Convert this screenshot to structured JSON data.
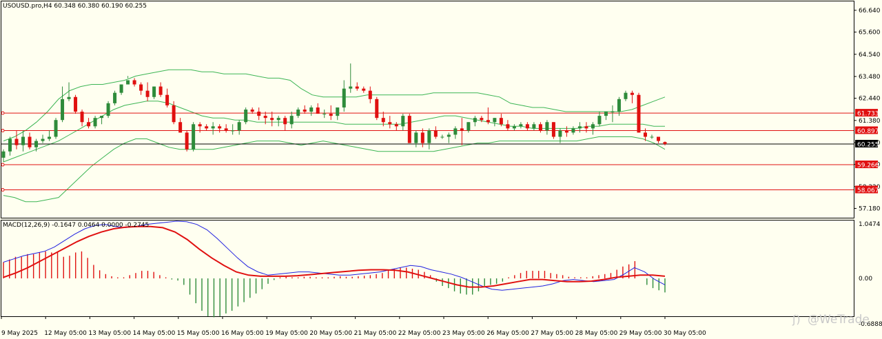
{
  "main_title": "USOUSD.pro,H4  60.348 60.380 60.190 60.255",
  "macd_title": "MACD(12,26,9) -0.1647 0.0464 0.0000 -0.2745",
  "watermark": "@WeTrade",
  "colors": {
    "bull": "#2e8b3a",
    "bear": "#e01010",
    "bands": "#3cb554",
    "macd_line": "#2020e0",
    "signal_line": "#e01010",
    "hline": "#e01010",
    "bg": "#fffff0"
  },
  "chart_data": [
    {
      "type": "candlestick",
      "symbol": "USOUSD.pro",
      "timeframe": "H4",
      "ohlc_label": "60.348 60.380 60.190 60.255",
      "ylim": [
        56.8,
        67.0
      ],
      "price_ticks": [
        "66.640",
        "65.600",
        "64.540",
        "63.480",
        "62.440",
        "61.380",
        "60.320",
        "59.280",
        "58.220",
        "57.180"
      ],
      "price_tags": [
        {
          "label": "61.733",
          "value": 61.733,
          "style": "red"
        },
        {
          "label": "60.897",
          "value": 60.897,
          "style": "red"
        },
        {
          "label": "60.255",
          "value": 60.255,
          "style": "current"
        },
        {
          "label": "59.266",
          "value": 59.266,
          "style": "red"
        },
        {
          "label": "58.067",
          "value": 58.067,
          "style": "red"
        }
      ],
      "horizontal_lines": [
        61.733,
        60.897,
        60.255,
        59.266,
        58.067
      ],
      "date_labels": [
        "9 May 2025",
        "12 May 05:00",
        "13 May 05:00",
        "14 May 05:00",
        "15 May 05:00",
        "16 May 05:00",
        "19 May 05:00",
        "20 May 05:00",
        "21 May 05:00",
        "22 May 05:00",
        "23 May 05:00",
        "26 May 05:00",
        "27 May 05:00",
        "28 May 05:00",
        "29 May 05:00",
        "30 May 05:00"
      ],
      "candles": [
        [
          59.6,
          60.0,
          59.4,
          59.9
        ],
        [
          59.9,
          60.6,
          59.7,
          60.5
        ],
        [
          60.5,
          60.9,
          60.0,
          60.2
        ],
        [
          60.2,
          60.9,
          59.9,
          60.6
        ],
        [
          60.6,
          60.8,
          60.0,
          60.1
        ],
        [
          60.1,
          60.5,
          59.9,
          60.4
        ],
        [
          60.4,
          60.7,
          60.3,
          60.5
        ],
        [
          60.5,
          60.9,
          60.4,
          60.6
        ],
        [
          60.6,
          61.5,
          60.5,
          61.4
        ],
        [
          61.4,
          63.0,
          61.3,
          62.4
        ],
        [
          62.4,
          63.2,
          62.3,
          62.5
        ],
        [
          62.5,
          62.6,
          61.7,
          61.8
        ],
        [
          61.8,
          61.9,
          61.1,
          61.3
        ],
        [
          61.3,
          61.5,
          61.0,
          61.1
        ],
        [
          61.1,
          61.6,
          61.0,
          61.5
        ],
        [
          61.5,
          61.6,
          61.2,
          61.6
        ],
        [
          61.6,
          62.3,
          61.5,
          62.2
        ],
        [
          62.2,
          62.8,
          62.1,
          62.7
        ],
        [
          62.7,
          63.1,
          62.6,
          63.1
        ],
        [
          63.1,
          63.5,
          63.4,
          63.3
        ],
        [
          63.3,
          63.4,
          63.0,
          63.1
        ],
        [
          63.1,
          63.2,
          62.6,
          62.8
        ],
        [
          62.8,
          63.2,
          62.3,
          62.5
        ],
        [
          62.5,
          63.0,
          62.4,
          63.0
        ],
        [
          63.0,
          63.2,
          62.5,
          62.6
        ],
        [
          62.6,
          62.9,
          62.0,
          62.1
        ],
        [
          62.1,
          62.3,
          61.2,
          61.3
        ],
        [
          61.3,
          61.5,
          60.8,
          60.8
        ],
        [
          60.8,
          60.9,
          59.9,
          60.0
        ],
        [
          60.0,
          61.3,
          59.9,
          61.2
        ],
        [
          61.2,
          61.3,
          60.8,
          61.1
        ],
        [
          61.1,
          61.2,
          60.9,
          61.0
        ],
        [
          61.0,
          61.3,
          60.7,
          61.1
        ],
        [
          61.1,
          61.2,
          60.8,
          61.0
        ],
        [
          61.0,
          61.2,
          60.8,
          60.9
        ],
        [
          60.9,
          61.2,
          60.7,
          60.9
        ],
        [
          60.9,
          61.4,
          60.7,
          61.3
        ],
        [
          61.3,
          62.0,
          61.2,
          61.9
        ],
        [
          61.9,
          62.0,
          61.7,
          61.8
        ],
        [
          61.8,
          62.0,
          61.4,
          61.6
        ],
        [
          61.6,
          61.8,
          61.2,
          61.5
        ],
        [
          61.5,
          61.8,
          61.1,
          61.4
        ],
        [
          61.4,
          61.6,
          61.1,
          61.5
        ],
        [
          61.5,
          61.6,
          60.9,
          61.2
        ],
        [
          61.2,
          61.8,
          61.0,
          61.6
        ],
        [
          61.6,
          62.0,
          61.5,
          61.9
        ],
        [
          61.9,
          62.1,
          61.7,
          61.8
        ],
        [
          61.8,
          62.1,
          61.6,
          62.0
        ],
        [
          62.0,
          62.2,
          61.7,
          61.7
        ],
        [
          61.7,
          61.9,
          61.5,
          61.7
        ],
        [
          61.7,
          62.1,
          61.4,
          61.6
        ],
        [
          61.6,
          62.0,
          61.4,
          62.0
        ],
        [
          62.0,
          63.3,
          61.8,
          62.9
        ],
        [
          62.9,
          64.1,
          62.7,
          63.0
        ],
        [
          63.0,
          63.2,
          62.8,
          62.9
        ],
        [
          62.9,
          63.0,
          62.7,
          62.8
        ],
        [
          62.8,
          63.0,
          62.2,
          62.4
        ],
        [
          62.4,
          62.5,
          61.4,
          61.5
        ],
        [
          61.5,
          61.8,
          61.1,
          61.3
        ],
        [
          61.3,
          61.6,
          61.0,
          61.2
        ],
        [
          61.2,
          61.3,
          60.9,
          61.1
        ],
        [
          61.1,
          61.7,
          60.9,
          61.6
        ],
        [
          61.6,
          61.7,
          60.3,
          60.3
        ],
        [
          60.3,
          60.9,
          60.1,
          60.8
        ],
        [
          60.8,
          61.0,
          60.1,
          60.3
        ],
        [
          60.3,
          61.0,
          60.0,
          60.9
        ],
        [
          60.9,
          61.1,
          60.5,
          60.6
        ],
        [
          60.6,
          60.7,
          60.5,
          60.6
        ],
        [
          60.6,
          60.8,
          60.3,
          60.7
        ],
        [
          60.7,
          61.1,
          60.5,
          61.0
        ],
        [
          61.0,
          61.5,
          60.2,
          60.9
        ],
        [
          60.9,
          61.3,
          60.8,
          61.3
        ],
        [
          61.3,
          61.6,
          61.1,
          61.5
        ],
        [
          61.5,
          61.6,
          61.3,
          61.4
        ],
        [
          61.4,
          62.0,
          61.2,
          61.3
        ],
        [
          61.3,
          61.5,
          61.1,
          61.5
        ],
        [
          61.5,
          61.7,
          61.1,
          61.2
        ],
        [
          61.2,
          61.4,
          60.9,
          61.0
        ],
        [
          61.0,
          61.2,
          60.9,
          61.1
        ],
        [
          61.1,
          61.3,
          61.0,
          61.2
        ],
        [
          61.2,
          61.3,
          60.9,
          61.0
        ],
        [
          61.0,
          61.3,
          60.9,
          61.2
        ],
        [
          61.2,
          61.3,
          60.8,
          60.9
        ],
        [
          60.9,
          61.4,
          60.7,
          61.3
        ],
        [
          61.3,
          61.3,
          60.5,
          60.6
        ],
        [
          60.6,
          61.0,
          60.3,
          60.9
        ],
        [
          60.9,
          61.1,
          60.6,
          60.8
        ],
        [
          60.8,
          61.1,
          60.7,
          61.0
        ],
        [
          61.0,
          61.3,
          60.8,
          61.1
        ],
        [
          61.1,
          61.3,
          60.8,
          61.0
        ],
        [
          61.0,
          61.3,
          60.7,
          61.2
        ],
        [
          61.2,
          61.8,
          61.1,
          61.6
        ],
        [
          61.6,
          61.7,
          61.4,
          61.8
        ],
        [
          61.8,
          62.1,
          61.3,
          61.8
        ],
        [
          61.8,
          62.5,
          61.6,
          62.4
        ],
        [
          62.4,
          62.8,
          62.3,
          62.7
        ],
        [
          62.7,
          62.8,
          62.2,
          62.6
        ],
        [
          62.6,
          62.7,
          60.8,
          60.8
        ],
        [
          60.8,
          61.0,
          60.4,
          60.6
        ],
        [
          60.6,
          60.7,
          60.5,
          60.6
        ],
        [
          60.6,
          60.6,
          60.3,
          60.4
        ],
        [
          60.348,
          60.38,
          60.19,
          60.255
        ]
      ],
      "bollinger_upper": [
        60.4,
        60.6,
        60.9,
        61.3,
        61.8,
        62.4,
        62.8,
        63.0,
        63.1,
        63.1,
        63.2,
        63.3,
        63.5,
        63.6,
        63.7,
        63.8,
        63.8,
        63.8,
        63.7,
        63.7,
        63.6,
        63.6,
        63.6,
        63.5,
        63.4,
        63.4,
        63.3,
        62.9,
        62.6,
        62.5,
        62.5,
        62.5,
        62.5,
        62.6,
        62.6,
        62.6,
        62.6,
        62.6,
        62.6,
        62.7,
        62.7,
        62.7,
        62.7,
        62.7,
        62.6,
        62.5,
        62.2,
        62.1,
        62.0,
        62.0,
        61.9,
        61.8,
        61.8,
        61.8,
        61.8,
        61.8,
        61.8,
        61.9,
        62.1,
        62.3,
        62.5
      ],
      "bollinger_middle": [
        59.4,
        59.6,
        59.8,
        60.0,
        60.2,
        60.4,
        60.7,
        61.0,
        61.3,
        61.6,
        61.9,
        62.1,
        62.2,
        62.3,
        62.3,
        62.2,
        62.0,
        61.8,
        61.6,
        61.5,
        61.5,
        61.4,
        61.4,
        61.3,
        61.3,
        61.3,
        61.3,
        61.3,
        61.3,
        61.3,
        61.3,
        61.2,
        61.2,
        61.2,
        61.2,
        61.2,
        61.2,
        61.3,
        61.4,
        61.5,
        61.6,
        61.6,
        61.5,
        61.4,
        61.3,
        61.2,
        61.1,
        61.1,
        61.0,
        61.0,
        61.0,
        61.0,
        61.0,
        61.1,
        61.1,
        61.2,
        61.2,
        61.2,
        61.2,
        61.1,
        61.1
      ],
      "bollinger_lower": [
        57.8,
        57.7,
        57.5,
        57.5,
        57.6,
        57.7,
        58.2,
        58.7,
        59.2,
        59.6,
        60.0,
        60.3,
        60.5,
        60.5,
        60.3,
        60.1,
        60.0,
        60.0,
        60.0,
        60.0,
        60.1,
        60.2,
        60.3,
        60.4,
        60.4,
        60.4,
        60.3,
        60.2,
        60.3,
        60.4,
        60.3,
        60.2,
        60.1,
        60.0,
        59.9,
        59.9,
        59.9,
        59.9,
        59.9,
        59.9,
        60.0,
        60.1,
        60.2,
        60.3,
        60.3,
        60.4,
        60.4,
        60.4,
        60.4,
        60.4,
        60.4,
        60.4,
        60.4,
        60.5,
        60.6,
        60.6,
        60.6,
        60.6,
        60.5,
        60.3,
        60.0
      ]
    },
    {
      "type": "macd",
      "title": "MACD(12,26,9)",
      "ylim": [
        -0.6888,
        1.0474
      ],
      "y_ticks": [
        "1.0474",
        "0.00",
        "-0.6888"
      ],
      "histogram": [
        0.3,
        0.35,
        0.4,
        0.4,
        0.45,
        0.45,
        0.48,
        0.5,
        0.48,
        0.48,
        0.4,
        0.42,
        0.48,
        0.5,
        0.38,
        0.25,
        0.15,
        0.08,
        0.04,
        0.02,
        0.02,
        0.06,
        0.1,
        0.14,
        0.14,
        0.12,
        0.06,
        0.02,
        -0.02,
        -0.04,
        -0.12,
        -0.3,
        -0.46,
        -0.6,
        -0.7,
        -0.72,
        -0.7,
        -0.65,
        -0.6,
        -0.52,
        -0.44,
        -0.36,
        -0.28,
        -0.2,
        -0.1,
        -0.03,
        0.02,
        0.03,
        0.02,
        0.02,
        0.03,
        0.03,
        0.02,
        0.02,
        0.02,
        0.03,
        0.04,
        0.03,
        0.03,
        0.04,
        0.05,
        0.06,
        0.08,
        0.1,
        0.16,
        0.18,
        0.2,
        0.2,
        0.18,
        0.16,
        0.12,
        0.06,
        -0.06,
        -0.14,
        -0.18,
        -0.24,
        -0.28,
        -0.3,
        -0.3,
        -0.24,
        -0.14,
        -0.12,
        -0.1,
        -0.06,
        0.02,
        0.06,
        0.1,
        0.14,
        0.14,
        0.14,
        0.14,
        0.1,
        0.08,
        0.06,
        0.03,
        0.02,
        0.02,
        0.02,
        0.04,
        0.06,
        0.08,
        0.1,
        0.16,
        0.22,
        0.26,
        0.32,
        0.0,
        -0.12,
        -0.18,
        -0.22,
        -0.26
      ],
      "macd_line": [
        0.3,
        0.36,
        0.42,
        0.46,
        0.5,
        0.58,
        0.7,
        0.82,
        0.92,
        0.98,
        1.0,
        0.96,
        0.94,
        0.96,
        1.0,
        1.02,
        1.04,
        1.06,
        1.05,
        1.0,
        0.9,
        0.74,
        0.56,
        0.38,
        0.22,
        0.12,
        0.06,
        0.08,
        0.1,
        0.12,
        0.12,
        0.1,
        0.08,
        0.06,
        0.06,
        0.08,
        0.1,
        0.12,
        0.16,
        0.2,
        0.24,
        0.22,
        0.16,
        0.12,
        0.08,
        0.02,
        -0.06,
        -0.14,
        -0.2,
        -0.22,
        -0.2,
        -0.18,
        -0.16,
        -0.14,
        -0.1,
        -0.04,
        -0.02,
        -0.04,
        -0.06,
        -0.04,
        -0.02,
        0.08,
        0.2,
        0.12,
        -0.02,
        -0.12
      ],
      "signal_line": [
        0.02,
        0.1,
        0.2,
        0.32,
        0.44,
        0.56,
        0.68,
        0.78,
        0.86,
        0.92,
        0.95,
        0.96,
        0.96,
        0.94,
        0.86,
        0.72,
        0.54,
        0.38,
        0.24,
        0.12,
        0.06,
        0.04,
        0.04,
        0.04,
        0.05,
        0.07,
        0.09,
        0.11,
        0.13,
        0.15,
        0.16,
        0.16,
        0.15,
        0.12,
        0.06,
        0.0,
        -0.06,
        -0.12,
        -0.16,
        -0.16,
        -0.14,
        -0.1,
        -0.06,
        -0.02,
        -0.02,
        -0.04,
        -0.06,
        -0.06,
        -0.05,
        -0.02,
        0.02,
        0.04,
        0.06,
        0.06,
        0.04
      ]
    }
  ]
}
